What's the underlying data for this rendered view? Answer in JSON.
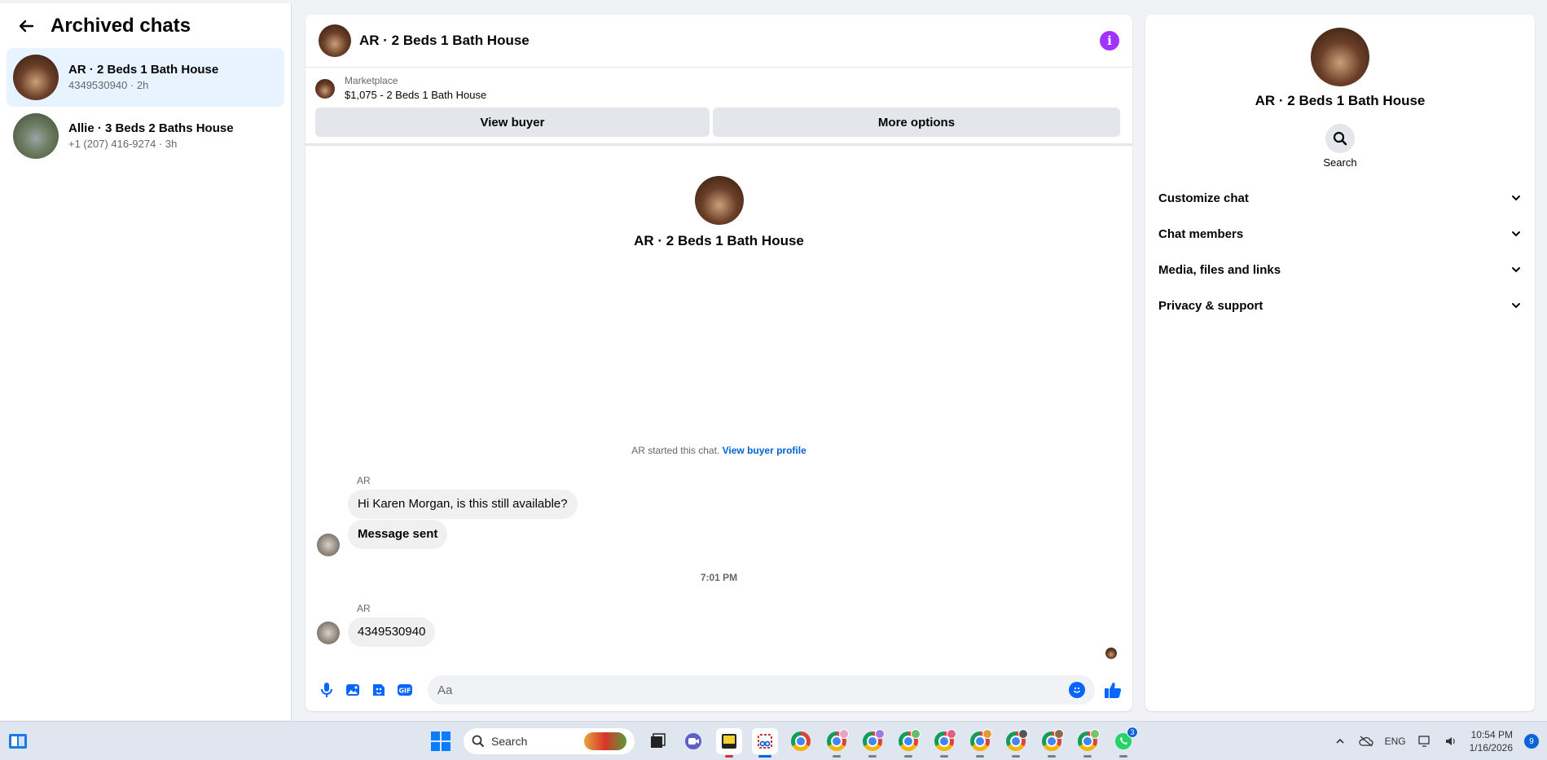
{
  "left": {
    "title": "Archived chats",
    "chats": [
      {
        "name": "AR · 2 Beds 1 Bath House",
        "sub": "4349530940 · 2h"
      },
      {
        "name": "Allie · 3 Beds 2 Baths House",
        "sub": "+1 (207) 416-9274 · 3h"
      }
    ]
  },
  "chat": {
    "title": "AR · 2 Beds 1 Bath House",
    "marketplace_label": "Marketplace",
    "listing": "$1,075 - 2 Beds 1 Bath House",
    "view_buyer": "View buyer",
    "more_options": "More options",
    "intro_name": "AR · 2 Beds 1 Bath House",
    "started_text": "AR started this chat.",
    "view_buyer_profile": "View buyer profile",
    "messages": [
      {
        "sender": "AR",
        "text": "Hi Karen Morgan, is this still available?"
      },
      {
        "text": "Message sent"
      },
      {
        "sender": "AR",
        "text": "4349530940"
      }
    ],
    "timestamp": "7:01 PM",
    "composer_placeholder": "Aa"
  },
  "right": {
    "name": "AR · 2 Beds 1 Bath House",
    "search_label": "Search",
    "sections": [
      "Customize chat",
      "Chat members",
      "Media, files and links",
      "Privacy & support"
    ]
  },
  "taskbar": {
    "search_label": "Search",
    "lang": "ENG",
    "time": "10:54 PM",
    "date": "1/16/2026",
    "notifications": "9",
    "whatsapp_badge": "3"
  },
  "colors": {
    "accent": "#0866ff",
    "active_bg": "#e7f3ff",
    "info": "#a033ff"
  }
}
